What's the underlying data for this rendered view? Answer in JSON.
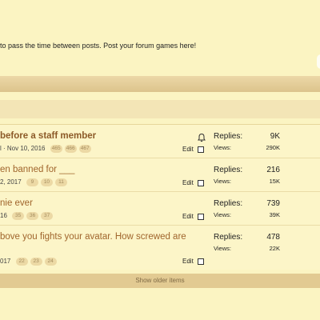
{
  "forum": {
    "description": "to pass the time between posts. Post your forum games here!"
  },
  "threads": [
    {
      "title": "before a staff member",
      "meta_text": "l · Nov 10, 2016",
      "pages": [
        "465",
        "466",
        "467"
      ],
      "edit_label": "Edit",
      "has_bell": true,
      "replies_label": "Replies:",
      "replies": "9K",
      "views_label": "Views:",
      "views": "290K"
    },
    {
      "title": "en banned for ___",
      "meta_text": "2, 2017",
      "pages": [
        "9",
        "10",
        "11"
      ],
      "edit_label": "Edit",
      "has_bell": false,
      "replies_label": "Replies:",
      "replies": "216",
      "views_label": "Views:",
      "views": "15K"
    },
    {
      "title": "nie ever",
      "meta_text": "16",
      "pages": [
        "35",
        "36",
        "37"
      ],
      "edit_label": "Edit",
      "has_bell": false,
      "replies_label": "Replies:",
      "replies": "739",
      "views_label": "Views:",
      "views": "39K"
    },
    {
      "title": "bove you fights your avatar. How screwed are",
      "meta_text": "017",
      "pages": [
        "22",
        "23",
        "24"
      ],
      "edit_label": "Edit",
      "has_bell": false,
      "replies_label": "Replies:",
      "replies": "478",
      "views_label": "Views:",
      "views": "22K"
    }
  ],
  "show_older_label": "Show older items",
  "colors": {
    "background": "#fbf4c2",
    "title": "#a0652c",
    "section_bar": "#e2ca92",
    "page_badge": "#ecd9a5"
  }
}
